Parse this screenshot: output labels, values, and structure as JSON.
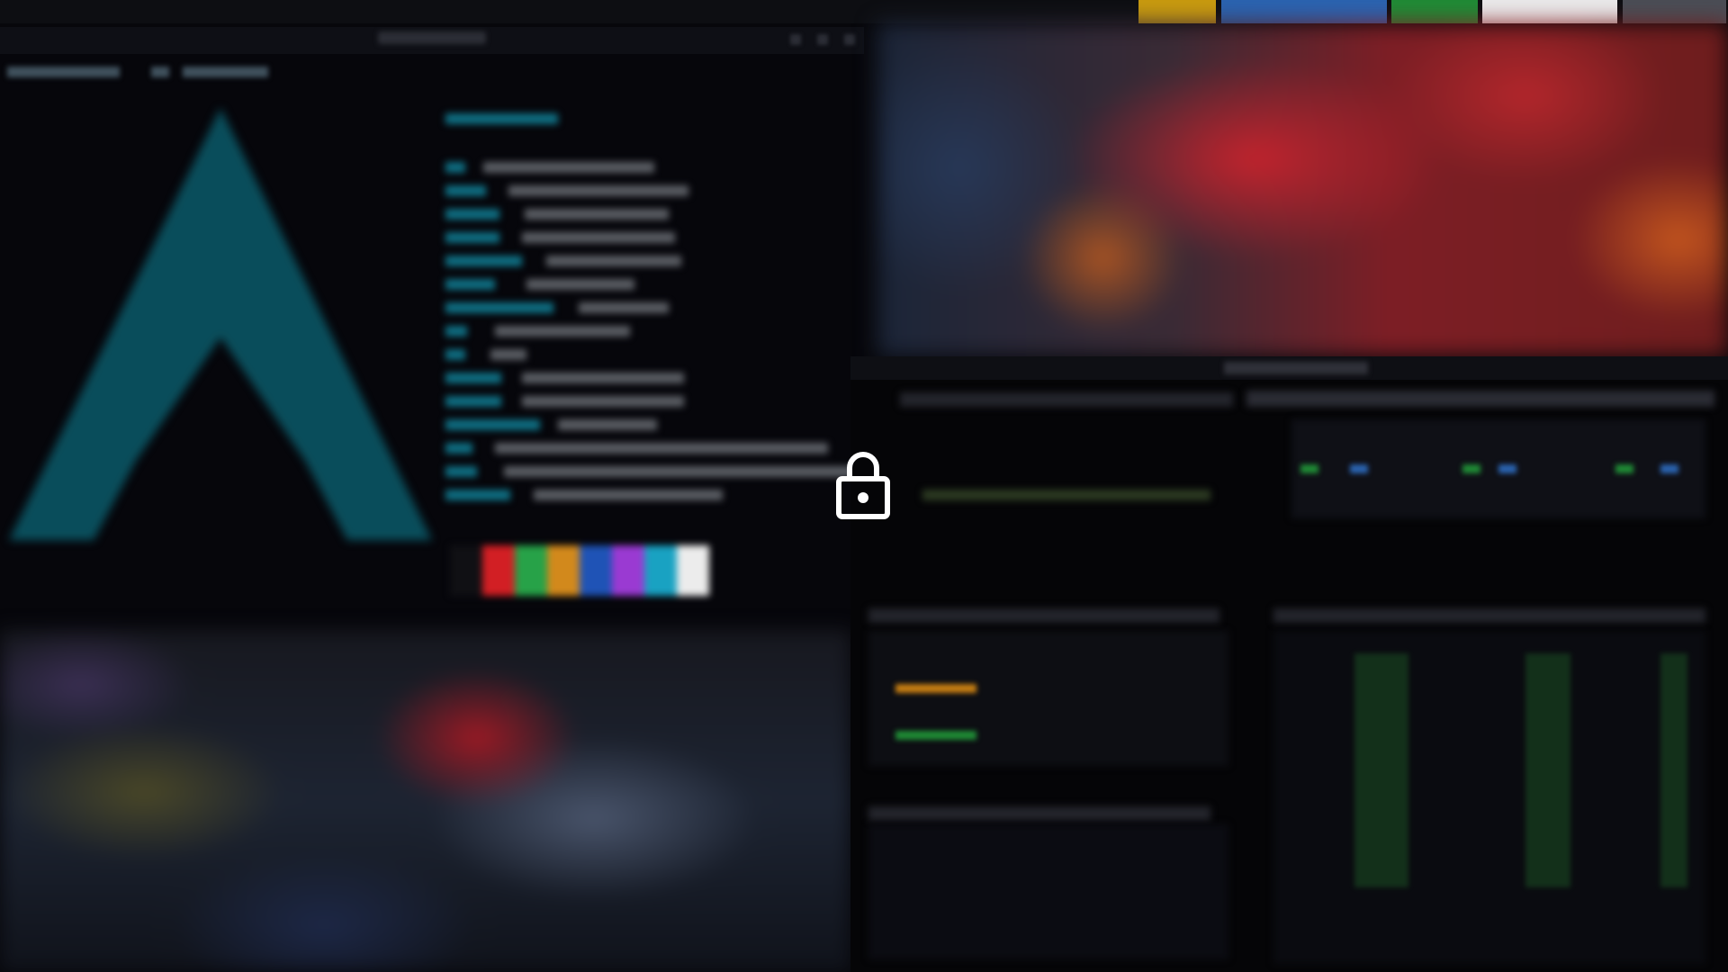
{
  "screen": {
    "state": "locked"
  },
  "colors": {
    "status_yellow": "#c89a0f",
    "status_blue": "#2a63b0",
    "status_green": "#1f8a35",
    "status_white": "#e9e9ea",
    "status_gray": "#4a4d55",
    "terminal_bg": "#06060b",
    "arch_logo": "#0b5a6a",
    "palette": [
      "#d21f24",
      "#27a248",
      "#d2891c",
      "#1f53b6",
      "#9a3ad2",
      "#19a2c2",
      "#ececec"
    ]
  },
  "icons": {
    "lock": "lock-icon"
  }
}
